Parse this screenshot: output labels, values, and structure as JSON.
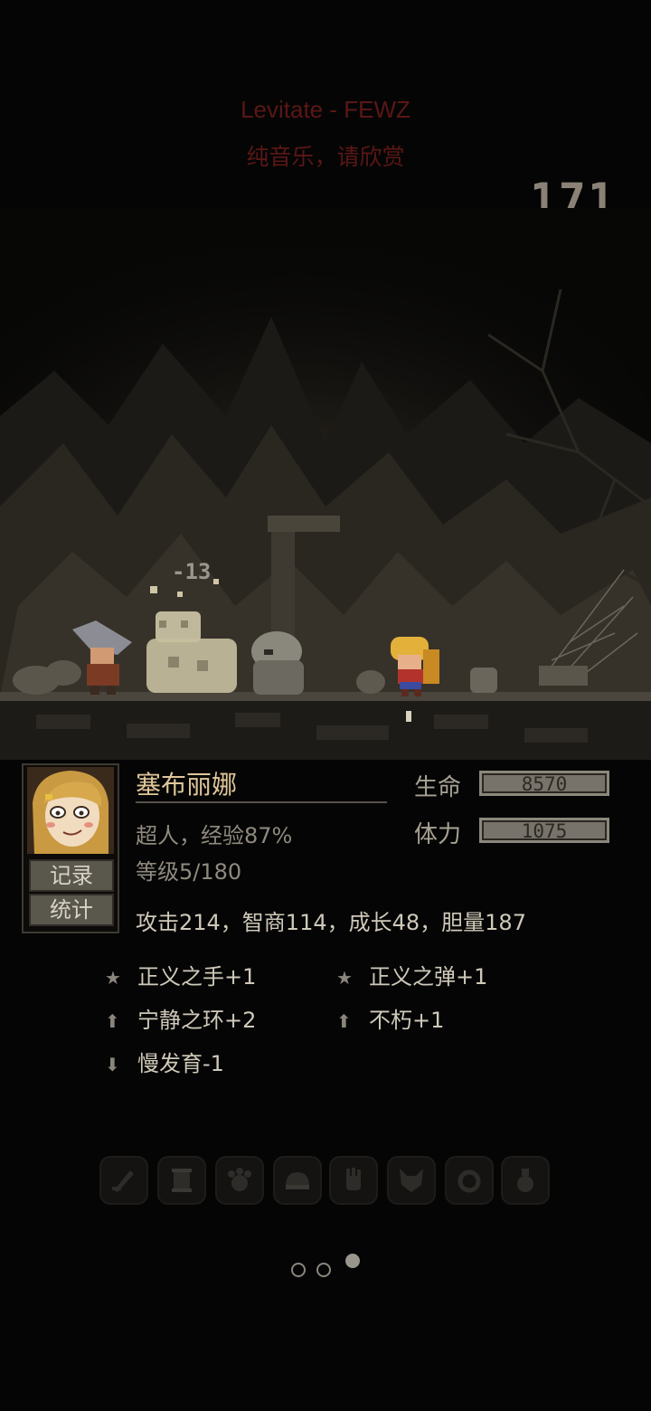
{
  "music": {
    "title": "Levitate - FEWZ",
    "subtitle": "纯音乐，请欣赏"
  },
  "counter": "171",
  "battle": {
    "damage_popup": "-13"
  },
  "character": {
    "name": "塞布丽娜",
    "class_exp": "超人，经验87%",
    "level": "等级5/180",
    "hp_label": "生命",
    "hp_value": "8570",
    "hp_fill": 1.0,
    "stamina_label": "体力",
    "stamina_value": "1075",
    "stamina_fill": 1.0,
    "attributes": "攻击214，智商114，成长48，胆量187"
  },
  "buttons": {
    "records": "记录",
    "stats": "统计"
  },
  "traits": [
    {
      "icon": "star-icon",
      "label": "正义之手+1"
    },
    {
      "icon": "star-icon",
      "label": "正义之弹+1"
    },
    {
      "icon": "arrow-up-icon",
      "label": "宁静之环+2"
    },
    {
      "icon": "arrow-up-icon",
      "label": "不朽+1"
    },
    {
      "icon": "arrow-down-icon",
      "label": "慢发育-1"
    }
  ],
  "skill_slots": [
    "sword-icon",
    "scroll-icon",
    "claw-icon",
    "helmet-icon",
    "hand-icon",
    "wolf-icon",
    "ring-icon",
    "potion-icon"
  ],
  "page_indicator": {
    "total": 3,
    "active": 3
  },
  "colors": {
    "background": "#050505",
    "title_red": "#5a1716",
    "name_gold": "#e0c79a",
    "bar_frame": "#8b877b"
  }
}
